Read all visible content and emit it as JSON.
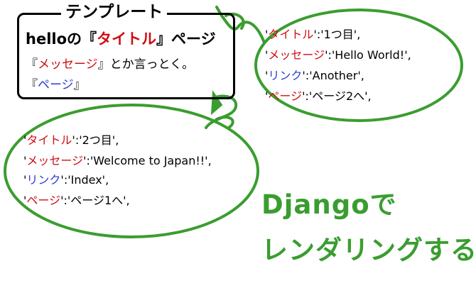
{
  "template": {
    "title": "テンプレート",
    "line1_prefix": "helloの『",
    "line1_var": "タイトル",
    "line1_suffix": "』ページ",
    "line2_open": "『",
    "line2_var": "メッセージ",
    "line2_rest": "』とか言っとく。",
    "line3_open": "『",
    "line3_var": "ページ",
    "line3_close": "』"
  },
  "context1": [
    {
      "key": "タイトル",
      "value": "'1つ目',",
      "color": "#d00c12"
    },
    {
      "key": "メッセージ",
      "value": "'Hello World!',",
      "color": "#d00c12"
    },
    {
      "key": "リンク",
      "value": "'Another',",
      "color": "#2b3bd6"
    },
    {
      "key": "ページ",
      "value": "'ページ2へ',",
      "color": "#d00c12"
    }
  ],
  "context2": [
    {
      "key": "タイトル",
      "value": "'2つ目',",
      "color": "#d00c12"
    },
    {
      "key": "メッセージ",
      "value": "'Welcome to Japan!!',",
      "color": "#d00c12"
    },
    {
      "key": "リンク",
      "value": "'Index',",
      "color": "#2b3bd6"
    },
    {
      "key": "ページ",
      "value": "'ページ1へ',",
      "color": "#d00c12"
    }
  ],
  "caption": {
    "line1": "Djangoで",
    "line2": "レンダリングする!"
  },
  "colors": {
    "accent_green": "#3a9d2f",
    "var_red": "#d00c12",
    "var_blue": "#2b3bd6"
  }
}
